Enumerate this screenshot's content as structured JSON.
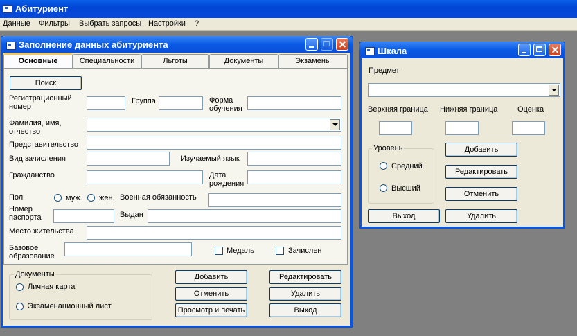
{
  "app": {
    "title": "Абитуриент"
  },
  "menu": [
    "Данные",
    "Фильтры",
    "Выбрать запросы",
    "Настройки",
    "?"
  ],
  "main_window": {
    "title": "Заполнение данных абитуриента",
    "tabs": [
      "Основные",
      "Специальности",
      "Льготы",
      "Документы",
      "Экзамены"
    ],
    "search_button": "Поиск",
    "fields": {
      "reg_number_1": "Регистрационный",
      "reg_number_2": "номер",
      "group": "Группа",
      "study_form_1": "Форма",
      "study_form_2": "обучения",
      "fio_1": "Фамилия, имя,",
      "fio_2": "отчество",
      "representation": "Представительство",
      "enrollment_type": "Вид зачисления",
      "language": "Изучаемый язык",
      "citizenship": "Гражданство",
      "birth_date_1": "Дата",
      "birth_date_2": "рождения",
      "sex": "Пол",
      "male": "муж.",
      "female": "жен.",
      "military": "Военная обязанность",
      "passport_1": "Номер",
      "passport_2": "паспорта",
      "issued": "Выдан",
      "residence": "Место жительства",
      "education_1": "Базовое",
      "education_2": "образование",
      "medal": "Медаль",
      "enrolled": "Зачислен"
    },
    "documents_group": {
      "label": "Документы",
      "options": [
        "Личная карта",
        "Экзаменационный лист"
      ]
    },
    "buttons": {
      "add": "Добавить",
      "edit": "Редактировать",
      "cancel": "Отменить",
      "delete": "Удалить",
      "print": "Просмотр и печать",
      "exit": "Выход"
    }
  },
  "scale_window": {
    "title": "Шкала",
    "subject": "Предмет",
    "upper": "Верхняя граница",
    "lower": "Нижняя граница",
    "grade": "Оценка",
    "level_group": {
      "label": "Уровень",
      "options": [
        "Средний",
        "Высший"
      ]
    },
    "buttons": {
      "add": "Добавить",
      "edit": "Редактировать",
      "cancel": "Отменить",
      "exit": "Выход",
      "delete": "Удалить"
    }
  }
}
